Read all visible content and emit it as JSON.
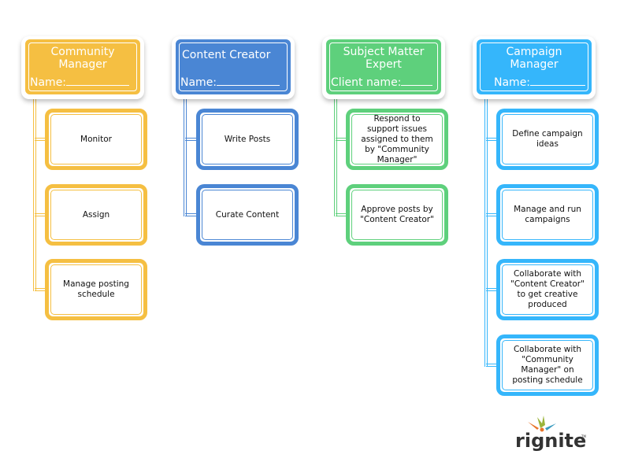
{
  "columns": [
    {
      "title": "Community Manager",
      "name_label": "Name:",
      "color": "#F5BF42",
      "children": [
        "Monitor",
        "Assign",
        "Manage posting schedule"
      ]
    },
    {
      "title": "Content Creator",
      "name_label": "Name:",
      "color": "#4A86D4",
      "children": [
        "Write Posts",
        "Curate Content"
      ]
    },
    {
      "title": "Subject Matter Expert",
      "name_label": "Client name:",
      "color": "#5ED07C",
      "children": [
        "Respond to support issues assigned to them by \"Community Manager\"",
        "Approve posts by \"Content Creator\""
      ]
    },
    {
      "title": "Campaign Manager",
      "name_label": "Name:",
      "color": "#35B6FB",
      "children": [
        "Define campaign ideas",
        "Manage and run campaigns",
        "Collaborate with \"Content Creator\" to get creative produced",
        "Collaborate with \"Community Manager\" on posting schedule"
      ]
    }
  ],
  "logo": {
    "text": "rignite"
  }
}
